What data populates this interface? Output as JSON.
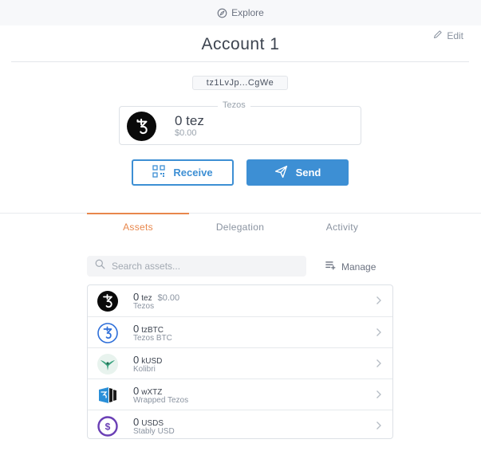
{
  "topbar": {
    "explore_label": "Explore"
  },
  "header": {
    "edit_label": "Edit",
    "account_name": "Account 1",
    "address": "tz1LvJp...CgWe"
  },
  "balance": {
    "legend": "Tezos",
    "amount": "0 tez",
    "fiat": "$0.00"
  },
  "actions": {
    "receive_label": "Receive",
    "send_label": "Send"
  },
  "tabs": [
    {
      "label": "Assets",
      "active": true
    },
    {
      "label": "Delegation",
      "active": false
    },
    {
      "label": "Activity",
      "active": false
    }
  ],
  "search": {
    "placeholder": "Search assets...",
    "value": ""
  },
  "manage_label": "Manage",
  "colors": {
    "accent": "#3d8fd4",
    "active_tab": "#e8874c",
    "tezos_black": "#0a0a0a"
  },
  "assets": [
    {
      "amount": "0",
      "symbol": "tez",
      "fiat": "$0.00",
      "name": "Tezos",
      "icon": "tezos-icon"
    },
    {
      "amount": "0",
      "symbol": "tzBTC",
      "name": "Tezos BTC",
      "icon": "tzbtc-icon"
    },
    {
      "amount": "0",
      "symbol": "kUSD",
      "name": "Kolibri",
      "icon": "kolibri-icon"
    },
    {
      "amount": "0",
      "symbol": "wXTZ",
      "name": "Wrapped Tezos",
      "icon": "wxtz-icon"
    },
    {
      "amount": "0",
      "symbol": "USDS",
      "name": "Stably USD",
      "icon": "stably-usd-icon"
    }
  ]
}
